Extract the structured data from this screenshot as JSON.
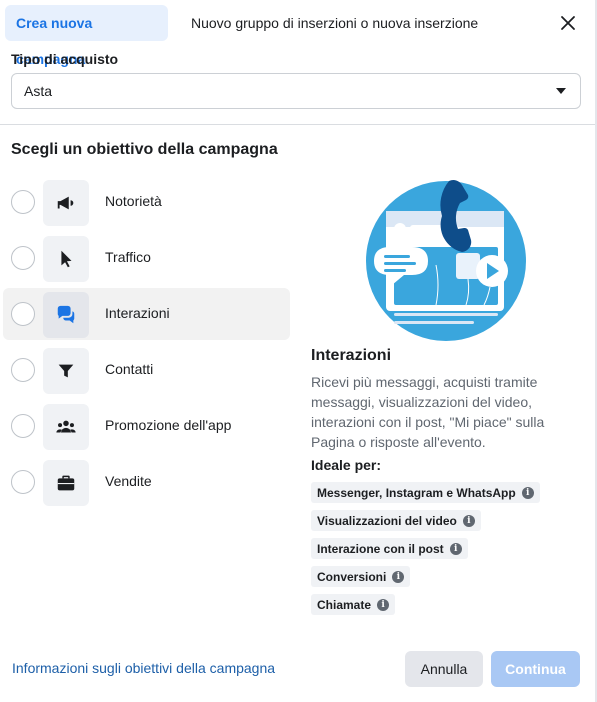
{
  "header": {
    "tab_active": "Crea nuova campagna",
    "tab_second": "Nuovo gruppo di inserzioni o nuova inserzione"
  },
  "buy_type": {
    "label": "Tipo di acquisto",
    "value": "Asta"
  },
  "objectives": {
    "title": "Scegli un obiettivo della campagna",
    "items": [
      {
        "label": "Notorietà",
        "icon": "megaphone-icon"
      },
      {
        "label": "Traffico",
        "icon": "cursor-icon"
      },
      {
        "label": "Interazioni",
        "icon": "chat-bubbles-icon"
      },
      {
        "label": "Contatti",
        "icon": "funnel-icon"
      },
      {
        "label": "Promozione dell'app",
        "icon": "people-icon"
      },
      {
        "label": "Vendite",
        "icon": "briefcase-icon"
      }
    ],
    "selected_index": 2
  },
  "detail": {
    "title": "Interazioni",
    "description": "Ricevi più messaggi, acquisti tramite messaggi, visualizzazioni del video, interazioni con il post, \"Mi piace\" sulla Pagina o risposte all'evento.",
    "ideal_label": "Ideale per:",
    "chips": [
      "Messenger, Instagram e WhatsApp",
      "Visualizzazioni del video",
      "Interazione con il post",
      "Conversioni",
      "Chiamate"
    ],
    "info_glyph": "i"
  },
  "footer": {
    "link": "Informazioni sugli obiettivi della campagna",
    "cancel": "Annulla",
    "continue": "Continua"
  },
  "colors": {
    "accent": "#1b74e4",
    "link": "#1d5fa8",
    "continue_disabled": "#a9c8f4",
    "illustration_blue": "#3aa6dd"
  }
}
